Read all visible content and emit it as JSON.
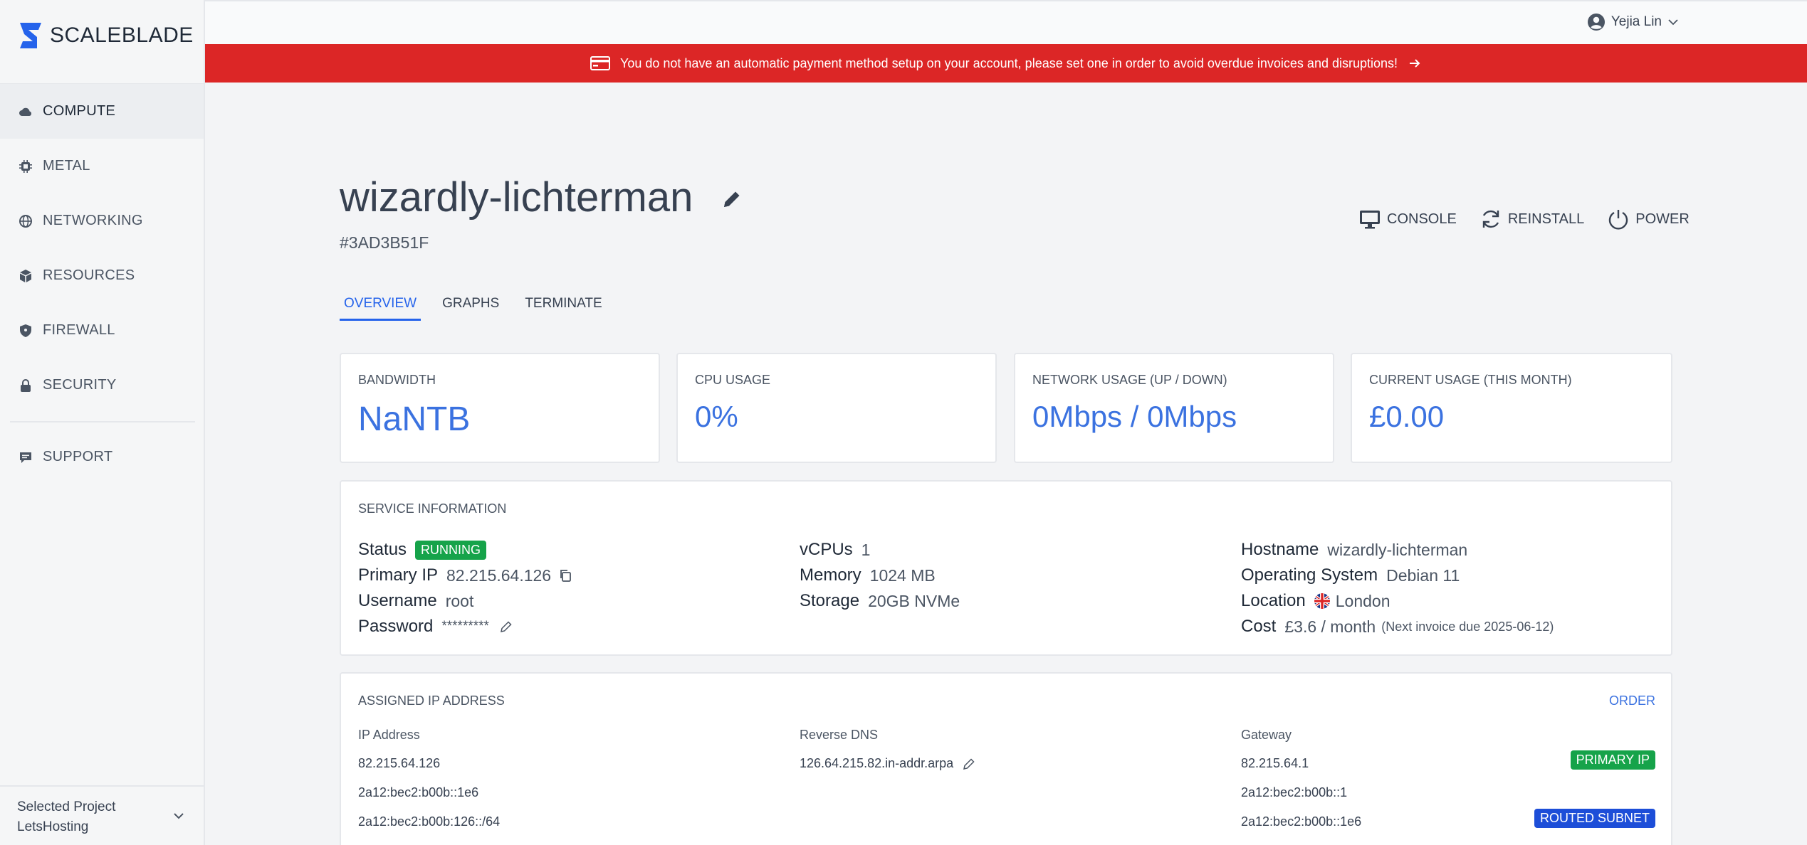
{
  "brand": {
    "name": "SCALEBLADE",
    "color": "#2563eb"
  },
  "sidebar": {
    "items": [
      {
        "label": "COMPUTE",
        "icon": "cloud-icon",
        "active": true
      },
      {
        "label": "METAL",
        "icon": "chip-icon"
      },
      {
        "label": "NETWORKING",
        "icon": "globe-icon"
      },
      {
        "label": "RESOURCES",
        "icon": "box-icon"
      },
      {
        "label": "FIREWALL",
        "icon": "shield-icon"
      },
      {
        "label": "SECURITY",
        "icon": "lock-icon"
      }
    ],
    "support": {
      "label": "SUPPORT",
      "icon": "chat-icon"
    },
    "project": {
      "label": "Selected Project",
      "value": "LetsHosting"
    }
  },
  "topbar": {
    "user": "Yejia Lin"
  },
  "alert": {
    "text": "You do not have an automatic payment method setup on your account, please set one in order to avoid overdue invoices and disruptions!",
    "color": "#dc2626"
  },
  "server": {
    "name": "wizardly-lichterman",
    "id": "#3AD3B51F"
  },
  "actions": {
    "console": "CONSOLE",
    "reinstall": "REINSTALL",
    "power": "POWER"
  },
  "tabs": {
    "overview": "OVERVIEW",
    "graphs": "GRAPHS",
    "terminate": "TERMINATE"
  },
  "stats": {
    "bandwidth": {
      "label": "BANDWIDTH",
      "value": "NaNTB"
    },
    "cpu": {
      "label": "CPU USAGE",
      "value": "0%"
    },
    "network": {
      "label": "NETWORK USAGE (UP / DOWN)",
      "value": "0Mbps / 0Mbps"
    },
    "current": {
      "label": "CURRENT USAGE (THIS MONTH)",
      "value": "£0.00"
    }
  },
  "service": {
    "title": "SERVICE INFORMATION",
    "status": {
      "key": "Status",
      "value": "RUNNING"
    },
    "primary_ip": {
      "key": "Primary IP",
      "value": "82.215.64.126"
    },
    "username": {
      "key": "Username",
      "value": "root"
    },
    "password": {
      "key": "Password",
      "value": "*********"
    },
    "vcpus": {
      "key": "vCPUs",
      "value": "1"
    },
    "memory": {
      "key": "Memory",
      "value": "1024 MB"
    },
    "storage": {
      "key": "Storage",
      "value": "20GB NVMe"
    },
    "hostname": {
      "key": "Hostname",
      "value": "wizardly-lichterman"
    },
    "os": {
      "key": "Operating System",
      "value": "Debian 11"
    },
    "location": {
      "key": "Location",
      "value": "London"
    },
    "cost": {
      "key": "Cost",
      "value": "£3.6 / month",
      "note": "(Next invoice due 2025-06-12)"
    }
  },
  "ips": {
    "title": "ASSIGNED IP ADDRESS",
    "order": "ORDER",
    "headers": {
      "ip": "IP Address",
      "rdns": "Reverse DNS",
      "gateway": "Gateway"
    },
    "rows": [
      {
        "ip": "82.215.64.126",
        "rdns": "126.64.215.82.in-addr.arpa",
        "gateway": "82.215.64.1",
        "badge": "PRIMARY IP"
      },
      {
        "ip": "2a12:bec2:b00b::1e6",
        "rdns": "",
        "gateway": "2a12:bec2:b00b::1",
        "badge": ""
      },
      {
        "ip": "2a12:bec2:b00b:126::/64",
        "rdns": "",
        "gateway": "2a12:bec2:b00b::1e6",
        "badge": "ROUTED SUBNET"
      }
    ]
  }
}
